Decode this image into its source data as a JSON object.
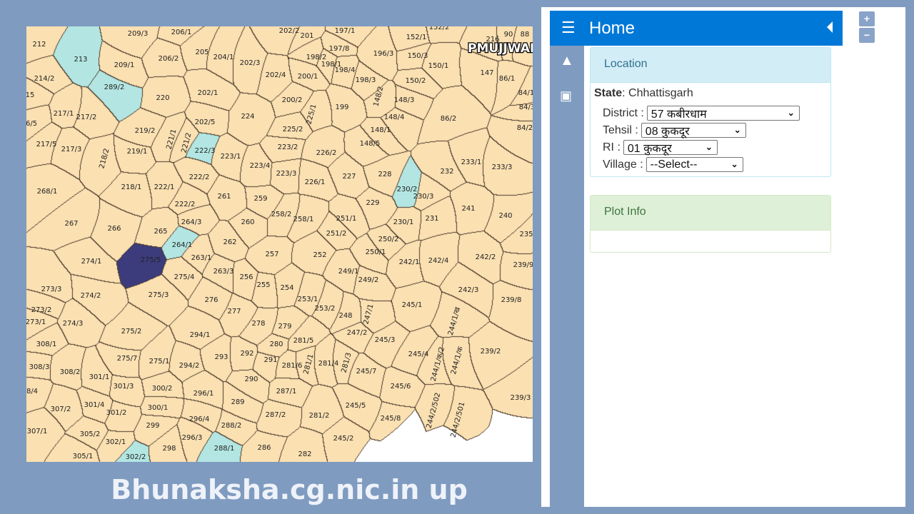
{
  "map": {
    "overlay_text": "PMUJJWALA",
    "colors": {
      "parcel": "#fbe0b2",
      "highlight": "#b3e6e2",
      "selected": "#3c3c7c",
      "border": "#4a3a2a",
      "unmapped": "#ffffff"
    },
    "selected_plot": "275/5",
    "plots": [
      "212",
      "209/3",
      "206/1",
      "202/2",
      "201",
      "197/1",
      "152/2",
      "152/1",
      "213",
      "209/1",
      "206/2",
      "205",
      "204/1",
      "202/3",
      "198/2",
      "197/8",
      "196/3",
      "150/3",
      "150/1",
      "147",
      "86/1",
      "214/2",
      "198/1",
      "198/4",
      "202/4",
      "200/1",
      "198/3",
      "150/2",
      "289/2",
      "220",
      "202/1",
      "15",
      "217/1",
      "217/2",
      "200/2",
      "199",
      "148/3",
      "225/1",
      "148/2",
      "224",
      "202/5",
      "148/4",
      "86/2",
      "84/2",
      "219/2",
      "225/2",
      "148/1",
      "6/5",
      "221/1",
      "221/2",
      "222/3",
      "217/5",
      "217/3",
      "219/1",
      "223/1",
      "148/5",
      "223/2",
      "226/2",
      "218/2",
      "223/4",
      "233/1",
      "233/3",
      "232",
      "228",
      "227",
      "223/3",
      "226/1",
      "222/2",
      "230/2",
      "230/3",
      "268/1",
      "218/1",
      "222/1",
      "261",
      "259",
      "229",
      "241",
      "240",
      "222/2",
      "258/2",
      "258/1",
      "251/1",
      "231",
      "230/1",
      "267",
      "266",
      "265",
      "264/3",
      "260",
      "251/2",
      "250/2",
      "235",
      "262",
      "264/1",
      "250/1",
      "242/4",
      "242/2",
      "274/1",
      "275/5",
      "263/1",
      "257",
      "252",
      "242/1",
      "239/9",
      "263/3",
      "249/1",
      "275/4",
      "256",
      "249/2",
      "273/3",
      "255",
      "254",
      "242/3",
      "274/2",
      "275/3",
      "276",
      "253/1",
      "239/8",
      "245/1",
      "273/2",
      "277",
      "253/2",
      "248",
      "247/1",
      "244/1/ख",
      "273/1",
      "274/3",
      "278",
      "279",
      "275/2",
      "294/1",
      "247/2",
      "245/3",
      "281/5",
      "280",
      "308/1",
      "239/2",
      "292",
      "293",
      "291",
      "281/6",
      "281/4",
      "281/3",
      "281/1",
      "245/4",
      "244/1/क/2",
      "244/1/क",
      "308/3",
      "275/7",
      "275/1",
      "294/2",
      "245/7",
      "308/2",
      "301/1",
      "290",
      "245/6",
      "301/3",
      "300/2",
      "296/1",
      "287/1",
      "8/4",
      "239/3",
      "307/2",
      "301/4",
      "301/2",
      "300/1",
      "289",
      "245/5",
      "296/4",
      "287/2",
      "281/2",
      "245/8",
      "244/2/502",
      "244/2/501",
      "307/1",
      "305/2",
      "302/1",
      "299",
      "296/3",
      "288/2",
      "245/2",
      "288/1",
      "298",
      "286",
      "282",
      "305/1",
      "302/2",
      "84/1",
      "84/3",
      "88",
      "90",
      "216"
    ]
  },
  "caption": "Bhunaksha.cg.nic.in up",
  "header": {
    "title": "Home",
    "menu_icon": "hamburger-icon",
    "collapse_icon": "caret-left-icon"
  },
  "sidebar": {
    "icons": [
      "tree-icon",
      "image-icon"
    ]
  },
  "location": {
    "title": "Location",
    "state_label": "State",
    "state_value": ": Chhattisgarh",
    "district_label": "District :",
    "district_value": "57 कबीरधाम",
    "tehsil_label": "Tehsil :",
    "tehsil_value": "08 कुकदूर",
    "ri_label": "RI :",
    "ri_value": "01 कुकदूर",
    "village_label": "Village :",
    "village_value": "--Select--"
  },
  "plot_info": {
    "title": "Plot Info"
  },
  "zoom_controls": {
    "plus": "+",
    "minus": "−"
  }
}
